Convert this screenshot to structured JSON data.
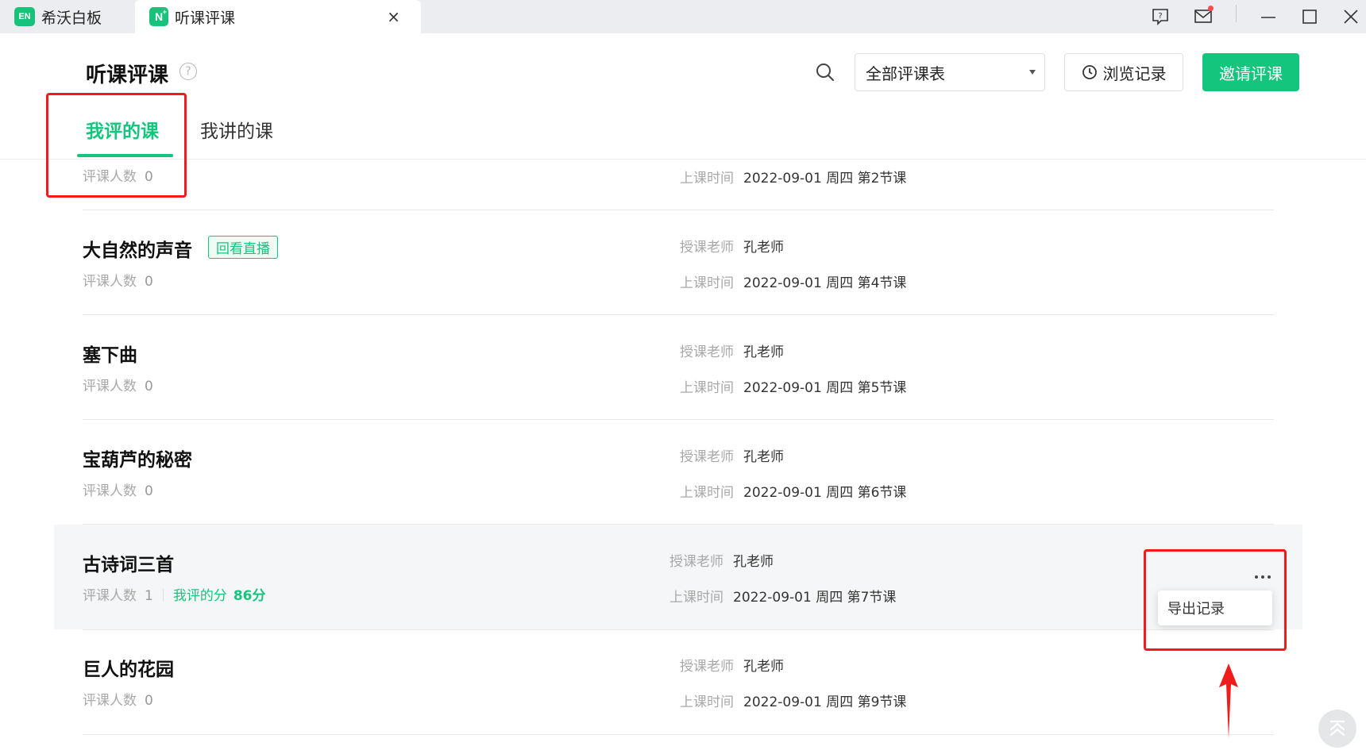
{
  "window": {
    "tabs": [
      {
        "label": "希沃白板",
        "logo": "EN"
      },
      {
        "label": "听课评课",
        "logo": "N",
        "close": "×"
      }
    ]
  },
  "header": {
    "title": "听课评课",
    "help": "?",
    "filter_value": "全部评课表",
    "history_label": "浏览记录",
    "invite_label": "邀请评课"
  },
  "subtabs": [
    {
      "label": "我评的课",
      "active": true
    },
    {
      "label": "我讲的课",
      "active": false
    }
  ],
  "labels": {
    "reviewers": "评课人数",
    "teacher": "授课老师",
    "time": "上课时间",
    "my_score": "我评的分",
    "replay": "回看直播"
  },
  "courses": [
    {
      "title": "",
      "reviewers": "0",
      "teacher": "",
      "time": "2022-09-01 周四 第2节课"
    },
    {
      "title": "大自然的声音",
      "replay": true,
      "reviewers": "0",
      "teacher": "孔老师",
      "time": "2022-09-01 周四 第4节课"
    },
    {
      "title": "塞下曲",
      "reviewers": "0",
      "teacher": "孔老师",
      "time": "2022-09-01 周四 第5节课"
    },
    {
      "title": "宝葫芦的秘密",
      "reviewers": "0",
      "teacher": "孔老师",
      "time": "2022-09-01 周四 第6节课"
    },
    {
      "title": "古诗词三首",
      "reviewers": "1",
      "my_score": "86分",
      "teacher": "孔老师",
      "time": "2022-09-01 周四 第7节课",
      "highlighted": true
    },
    {
      "title": "巨人的花园",
      "reviewers": "0",
      "teacher": "孔老师",
      "time": "2022-09-01 周四 第9节课"
    }
  ],
  "more_menu": {
    "items": [
      "导出记录"
    ]
  },
  "colors": {
    "accent": "#14c57d",
    "annotation": "#f21b1b",
    "titlebar": "#ebedf0"
  }
}
